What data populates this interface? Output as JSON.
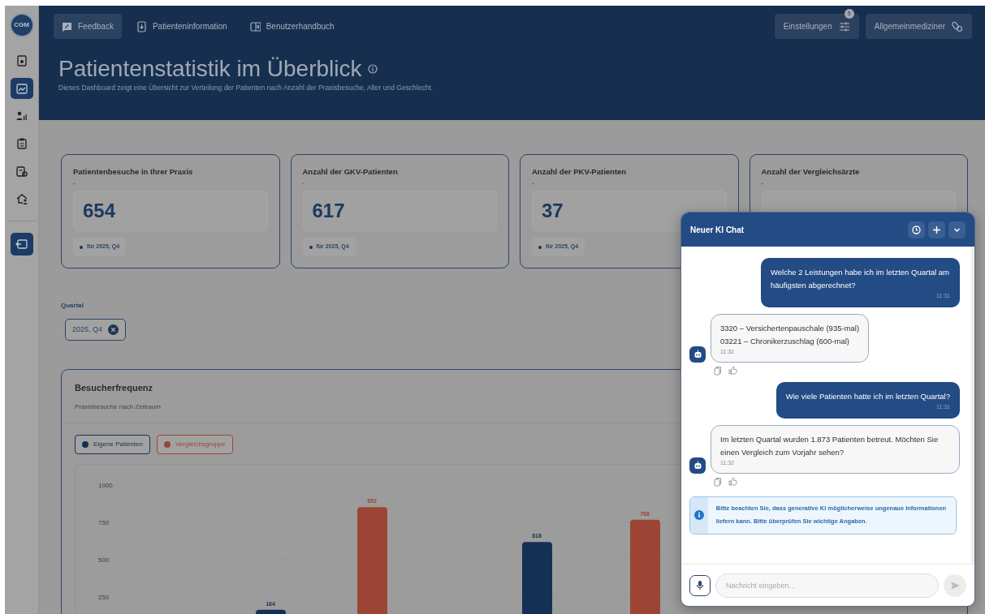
{
  "sidebar": {
    "logo": "CGM",
    "items": [
      {
        "selected": false
      },
      {
        "selected": true
      },
      {
        "selected": false
      },
      {
        "selected": false
      },
      {
        "selected": false
      },
      {
        "selected": false
      }
    ]
  },
  "header": {
    "nav": [
      {
        "label": "Feedback",
        "selected": true
      },
      {
        "label": "Patienteninformation",
        "selected": false
      },
      {
        "label": "Benutzerhandbuch",
        "selected": false
      }
    ],
    "buttons": [
      {
        "label": "Einstellungen",
        "badge": "5"
      },
      {
        "label": "Allgemeinmediziner"
      }
    ],
    "title": "Patientenstatistik im Überblick",
    "subtitle": "Dieses Dashboard zeigt eine Übersicht zur Verteilung der Patienten nach Anzahl der Praxisbesuche, Alter und Geschlecht."
  },
  "kpis": [
    {
      "title": "Patientenbesuche in Ihrer Praxis",
      "note": "-",
      "value": "654",
      "period": "für 2025, Q4"
    },
    {
      "title": "Anzahl der GKV-Patienten",
      "note": "-",
      "value": "617",
      "period": "für 2025, Q4"
    },
    {
      "title": "Anzahl der PKV-Patienten",
      "note": "-",
      "value": "37",
      "period": "für 2025, Q4"
    },
    {
      "title": "Anzahl der Vergleichsärzte",
      "note": "-"
    }
  ],
  "filter": {
    "label": "Quartal",
    "chips": [
      {
        "label": "2025, Q4"
      }
    ]
  },
  "chart_panel": {
    "title": "Besucherfrequenz",
    "subtitle": "Praxisbesuche nach Zeitraum",
    "chart_data": {
      "type": "bar",
      "ylim": [
        0,
        1000
      ],
      "yticks": [
        250,
        500,
        750,
        1000
      ],
      "grid": true,
      "data_labels": true,
      "series": [
        {
          "name": "Eigene Patienten",
          "color": "#143054",
          "values": [
            164,
            618
          ]
        },
        {
          "name": "Vergleichsgruppe",
          "color": "#9c4535",
          "values": [
            852,
            768
          ]
        }
      ]
    }
  },
  "chat": {
    "title": "Neuer KI Chat",
    "messages": [
      {
        "kind": "user",
        "text": "Welche 2 Leistungen habe ich im letzten Quartal am häufigsten abgerechnet?",
        "time": "11:31"
      },
      {
        "kind": "bot",
        "text": "3320 – Versichertenpauschale (935-mal)\n03221 – Chronikerzuschlag (600-mal)",
        "time": "11:32"
      },
      {
        "kind": "user",
        "text": "Wie viele Patienten hatte ich im letzten Quartal?",
        "time": "11:31"
      },
      {
        "kind": "bot",
        "text": "Im letzten Quartal wurden 1.873 Patienten betreut. Möchten Sie einen Vergleich zum Vorjahr sehen?",
        "time": "11:32"
      }
    ],
    "notice": "Bitte beachten Sie, dass generative KI möglicherweise ungenaue Informationen liefern kann. Bitte überprüfen Sie wichtige Angaben.",
    "placeholder": "Nachricht eingeben..."
  }
}
